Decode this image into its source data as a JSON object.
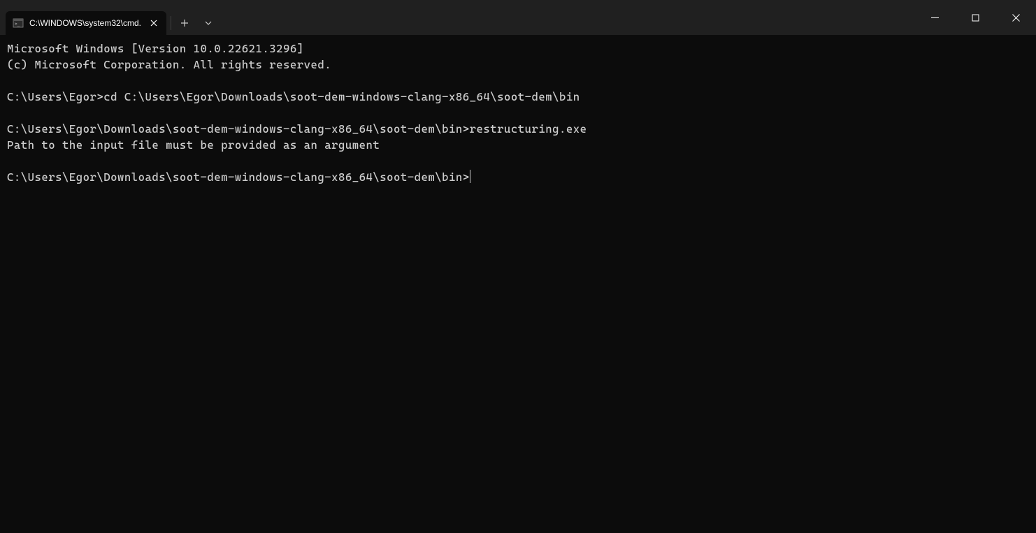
{
  "titlebar": {
    "tab": {
      "title": "C:\\WINDOWS\\system32\\cmd."
    }
  },
  "terminal": {
    "line1": "Microsoft Windows [Version 10.0.22621.3296]",
    "line2": "(c) Microsoft Corporation. All rights reserved.",
    "blank1": "",
    "prompt1": "C:\\Users\\Egor>",
    "cmd1": "cd C:\\Users\\Egor\\Downloads\\soot-dem-windows-clang-x86_64\\soot-dem\\bin",
    "blank2": "",
    "prompt2": "C:\\Users\\Egor\\Downloads\\soot-dem-windows-clang-x86_64\\soot-dem\\bin>",
    "cmd2": "restructuring.exe",
    "output1": "Path to the input file must be provided as an argument",
    "blank3": "",
    "prompt3": "C:\\Users\\Egor\\Downloads\\soot-dem-windows-clang-x86_64\\soot-dem\\bin>"
  }
}
